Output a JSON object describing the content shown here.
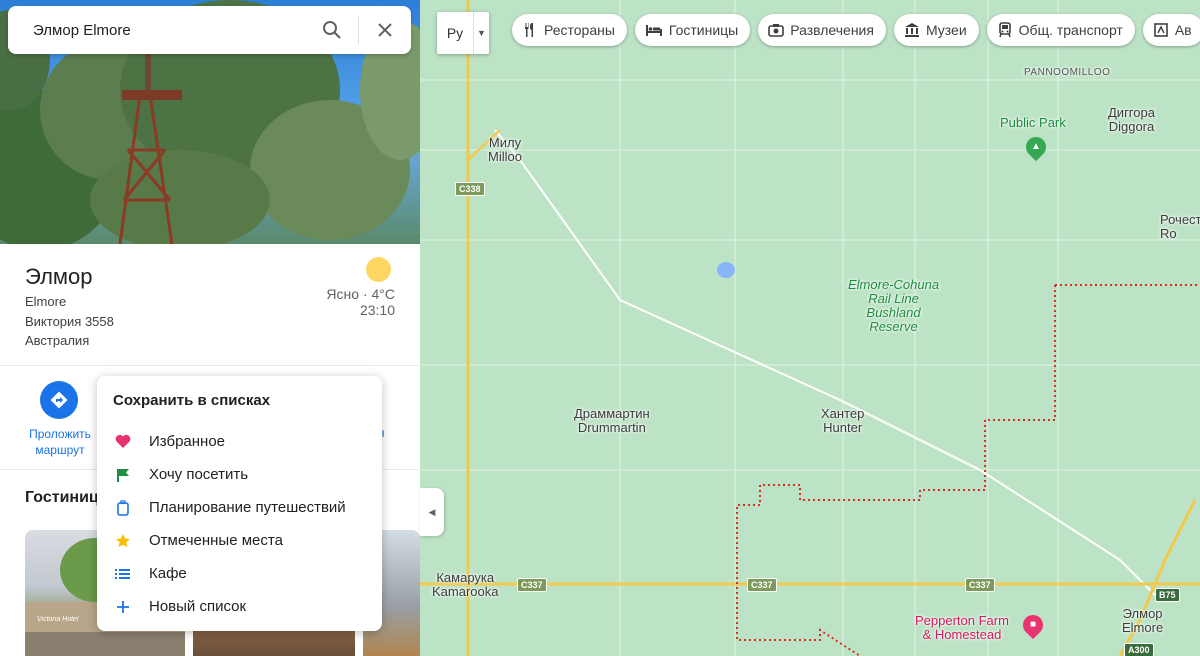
{
  "search": {
    "value": "Элмор Elmore"
  },
  "place": {
    "title": "Элмор",
    "line1": "Elmore",
    "line2": "Виктория 3558",
    "line3": "Австралия"
  },
  "weather": {
    "condition": "Ясно · 4°C",
    "time": "23:10"
  },
  "actions": {
    "route_label": "Проложить маршрут",
    "partial_label": "ся"
  },
  "hotels_heading": "Гостиниц",
  "hotel_sign": "Victoria Hotel",
  "save_menu": {
    "title": "Сохранить в списках",
    "items": [
      {
        "label": "Избранное",
        "icon": "heart-icon",
        "color": "#e8336f"
      },
      {
        "label": "Хочу посетить",
        "icon": "flag-icon",
        "color": "#1e8e3e"
      },
      {
        "label": "Планирование путешествий",
        "icon": "suitcase-icon",
        "color": "#1a73e8"
      },
      {
        "label": "Отмеченные места",
        "icon": "star-icon",
        "color": "#fbbc04"
      },
      {
        "label": "Кафе",
        "icon": "list-icon",
        "color": "#1a73e8"
      },
      {
        "label": "Новый список",
        "icon": "plus-icon",
        "color": "#1a73e8"
      }
    ]
  },
  "map": {
    "layer_toggle": "Ру",
    "chips": [
      {
        "label": "Рестораны",
        "icon": "restaurant-icon"
      },
      {
        "label": "Гостиницы",
        "icon": "hotel-icon"
      },
      {
        "label": "Развлечения",
        "icon": "camera-icon"
      },
      {
        "label": "Музеи",
        "icon": "museum-icon"
      },
      {
        "label": "Общ. транспорт",
        "icon": "transit-icon"
      },
      {
        "label": "Ав",
        "icon": "more-icon"
      }
    ],
    "labels": {
      "pannoomilloo": "PANNOOMILLOO",
      "milloo": "Милу\nMilloo",
      "public_park": "Public Park",
      "diggora": "Диггора\nDiggora",
      "rochester": "Рочесте\nRo",
      "elmore_cohuna": "Elmore-Cohuna\nRail Line\nBushland\nReserve",
      "drummartin": "Драммартин\nDrummartin",
      "hunter": "Хантер\nHunter",
      "kamarooka": "Камарука\nKamarooka",
      "pepperton": "Pepperton Farm\n& Homestead",
      "elmore": "Элмор\nElmore"
    },
    "shields": {
      "c338": "C338",
      "c337a": "C337",
      "c337b": "C337",
      "c337c": "C337",
      "b75": "B75",
      "a300": "A300"
    }
  }
}
